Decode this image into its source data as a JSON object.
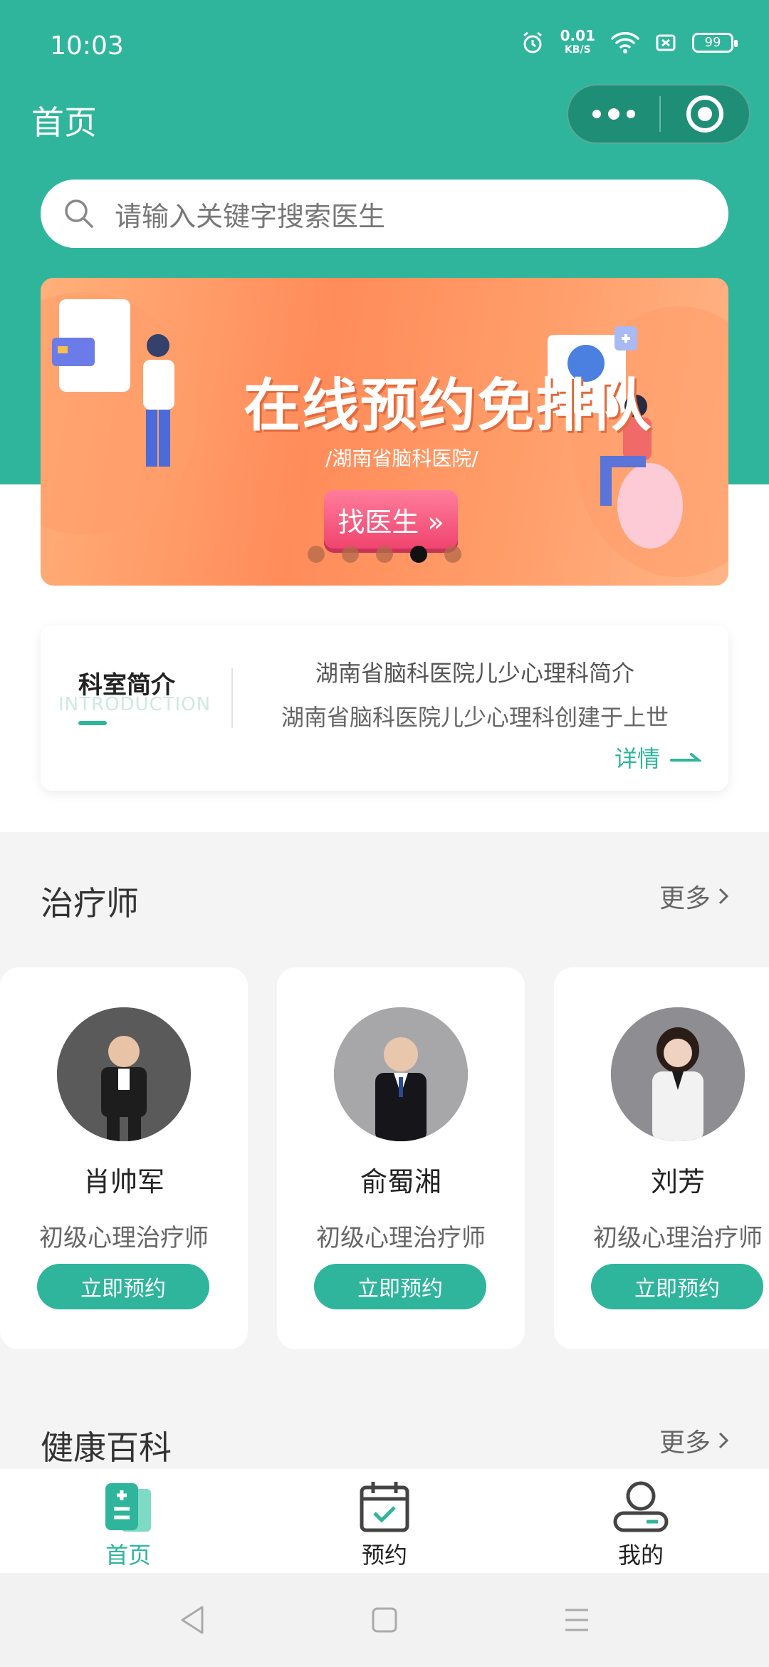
{
  "status": {
    "time": "10:03",
    "net_speed": "0.01",
    "net_unit": "KB/S",
    "battery": "99"
  },
  "nav": {
    "title": "首页"
  },
  "search": {
    "placeholder": "请输入关键字搜索医生"
  },
  "banner": {
    "title": "在线预约免排队",
    "subtitle": "/湖南省脑科医院/",
    "button": "找医生 »",
    "dots": 5,
    "active_dot": 3
  },
  "intro": {
    "heading": "科室简介",
    "heading_en": "INTRODUCTION",
    "title": "湖南省脑科医院儿少心理科简介",
    "text": "湖南省脑科医院儿少心理科创建于上世",
    "more": "详情"
  },
  "therapists": {
    "title": "治疗师",
    "more": "更多",
    "items": [
      {
        "name": "肖帅军",
        "role": "初级心理治疗师",
        "button": "立即预约"
      },
      {
        "name": "俞蜀湘",
        "role": "初级心理治疗师",
        "button": "立即预约"
      },
      {
        "name": "刘芳",
        "role": "初级心理治疗师",
        "button": "立即预约"
      }
    ]
  },
  "health": {
    "title": "健康百科",
    "more": "更多"
  },
  "tabbar": {
    "items": [
      {
        "label": "首页",
        "icon": "home-doc-icon",
        "active": true
      },
      {
        "label": "预约",
        "icon": "calendar-check-icon",
        "active": false
      },
      {
        "label": "我的",
        "icon": "user-icon",
        "active": false
      }
    ]
  },
  "colors": {
    "primary": "#2fb59b",
    "banner": "#ff8c5a"
  }
}
